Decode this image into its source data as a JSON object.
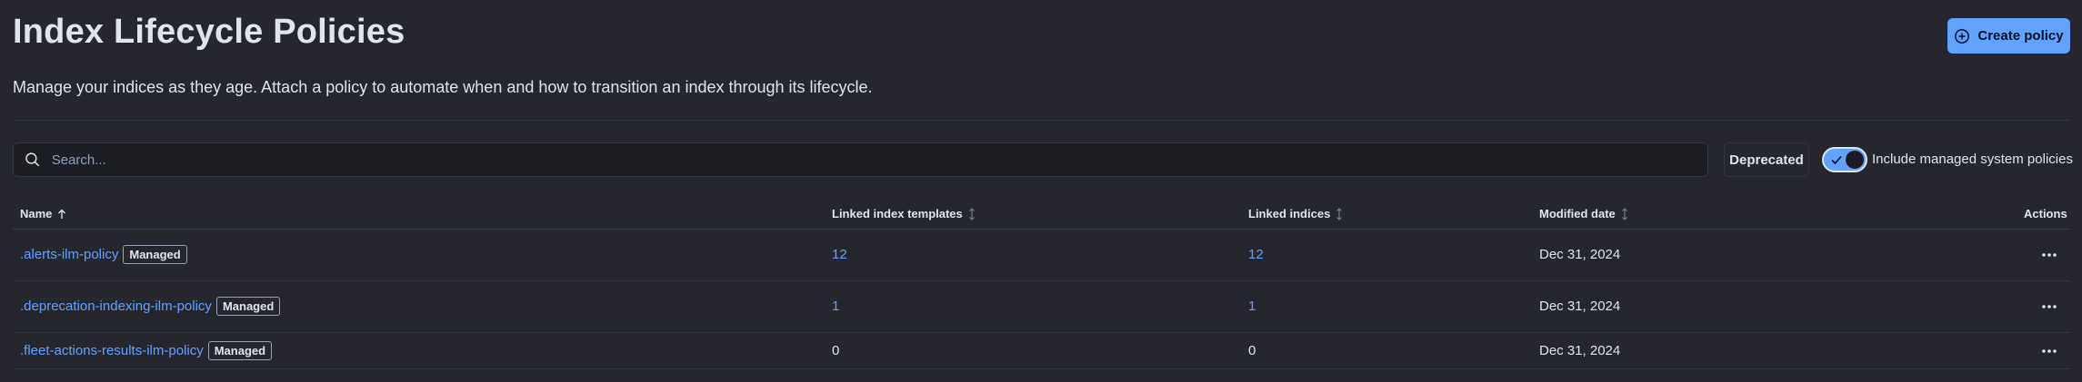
{
  "header": {
    "title": "Index Lifecycle Policies",
    "create_label": "Create policy",
    "description": "Manage your indices as they age. Attach a policy to automate when and how to transition an index through its lifecycle."
  },
  "toolbar": {
    "search_placeholder": "Search...",
    "deprecated_label": "Deprecated",
    "toggle_label": "Include managed system policies",
    "toggle_on": true
  },
  "table": {
    "columns": [
      "Name",
      "Linked index templates",
      "Linked indices",
      "Modified date",
      "Actions"
    ],
    "sorted_column": "Name",
    "sort_direction": "ascending",
    "rows": [
      {
        "name": ".alerts-ilm-policy",
        "badge": "Managed",
        "templates": "12",
        "indices": "12",
        "modified": "Dec 31, 2024"
      },
      {
        "name": ".deprecation-indexing-ilm-policy",
        "badge": "Managed",
        "templates": "1",
        "indices": "1",
        "modified": "Dec 31, 2024"
      },
      {
        "name": ".fleet-actions-results-ilm-policy",
        "badge": "Managed",
        "templates": "0",
        "indices": "0",
        "modified": "Dec 31, 2024"
      }
    ]
  },
  "icons": {
    "create": "plus-in-circle-icon",
    "search": "search-icon",
    "sort_asc": "arrow-up-icon",
    "sortable": "sort-arrows-icon",
    "actions": "ellipsis-icon",
    "toggle_check": "check-icon"
  },
  "colors": {
    "background": "#25262e",
    "accent": "#61a2ff",
    "text": "#dfe5ef",
    "border": "#343741"
  }
}
